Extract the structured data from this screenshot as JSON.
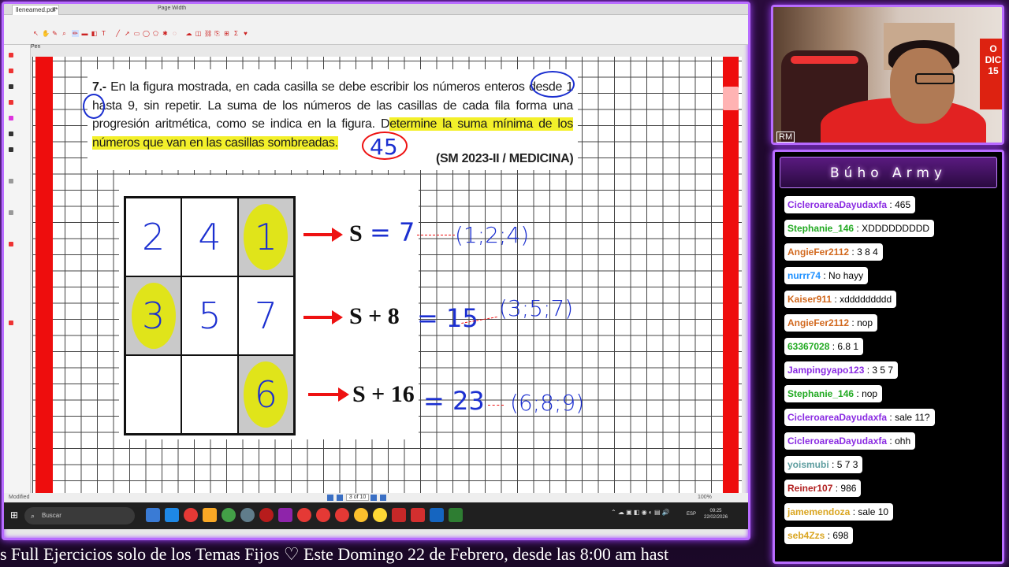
{
  "app": {
    "tab_title": "lleneamed.pdf*",
    "tab_close": "×",
    "toolbar_page_width": "Page Width",
    "pen_label": "Pen",
    "status_modified": "Modified",
    "page_indicator": "3 of 10",
    "zoom_label": "100%"
  },
  "problem": {
    "number": "7.-",
    "text_part1": " En la figura mostrada, en cada casilla se debe escribir los números enteros desde 1 hasta 9, sin repetir. La suma de los números de las casillas de cada fila forma una progresión aritmética, como se indica en la figura. D",
    "text_highlight": "etermine la suma mínima de los números que van en las casillas sombreadas.",
    "source": "(SM 2023-II / MEDICINA)",
    "answer_annotation": "45"
  },
  "grid": {
    "rows": [
      [
        {
          "value": "2",
          "shaded": false
        },
        {
          "value": "4",
          "shaded": false
        },
        {
          "value": "1",
          "shaded": true
        }
      ],
      [
        {
          "value": "3",
          "shaded": true
        },
        {
          "value": "5",
          "shaded": false
        },
        {
          "value": "7",
          "shaded": false
        }
      ],
      [
        {
          "value": "",
          "shaded": false
        },
        {
          "value": "",
          "shaded": false
        },
        {
          "value": "6",
          "shaded": true
        }
      ]
    ],
    "row_labels": [
      "S",
      "S + 8",
      "S + 16"
    ],
    "row_results": [
      "= 7",
      "= 15",
      "= 23"
    ],
    "row_sets": [
      "(1;2;4)",
      "(3;5;7)",
      "(6;8;9)"
    ]
  },
  "taskbar": {
    "search_placeholder": "Buscar",
    "language": "ESP",
    "time": "09:25",
    "date": "22/02/2026"
  },
  "webcam": {
    "corner_label": "RM",
    "sign_text": "O\nDIC\n15"
  },
  "chat": {
    "title": "Búho Army",
    "messages": [
      {
        "user": "CicleroareaDayudaxfa",
        "text": "465",
        "color": "#8a2be2"
      },
      {
        "user": "Stephanie_146",
        "text": "XDDDDDDDDD",
        "color": "#22aa22"
      },
      {
        "user": "AngieFer2112",
        "text": "3 8 4",
        "color": "#d2691e"
      },
      {
        "user": "nurrr74",
        "text": "No hayy",
        "color": "#1e90ff"
      },
      {
        "user": "Kaiser911",
        "text": "xddddddddd",
        "color": "#d2691e"
      },
      {
        "user": "AngieFer2112",
        "text": "nop",
        "color": "#d2691e"
      },
      {
        "user": "63367028",
        "text": "6.8 1",
        "color": "#22aa22"
      },
      {
        "user": "Jampingyapo123",
        "text": "3 5 7",
        "color": "#8a2be2"
      },
      {
        "user": "Stephanie_146",
        "text": "nop",
        "color": "#22aa22"
      },
      {
        "user": "CicleroareaDayudaxfa",
        "text": "sale 11?",
        "color": "#8a2be2"
      },
      {
        "user": "CicleroareaDayudaxfa",
        "text": "ohh",
        "color": "#8a2be2"
      },
      {
        "user": "yoismubi",
        "text": "5 7 3",
        "color": "#5f9ea0"
      },
      {
        "user": "Reiner107",
        "text": "986",
        "color": "#b22222"
      },
      {
        "user": "jamemendoza",
        "text": "sale 10",
        "color": "#daa520"
      },
      {
        "user": "seb4Zzs",
        "text": "698",
        "color": "#daa520"
      }
    ]
  },
  "ticker": {
    "text": "s Full Ejercicios solo de los Temas Fijos ♡     Este Domingo 22 de Febrero, desde las 8:00 am hast"
  },
  "colors": {
    "frame_accent": "#b86cff",
    "red_bars": "#ee0d0d",
    "ink_blue": "#1b2fd0",
    "ink_red": "#e11111",
    "highlight": "#f3f02a"
  }
}
